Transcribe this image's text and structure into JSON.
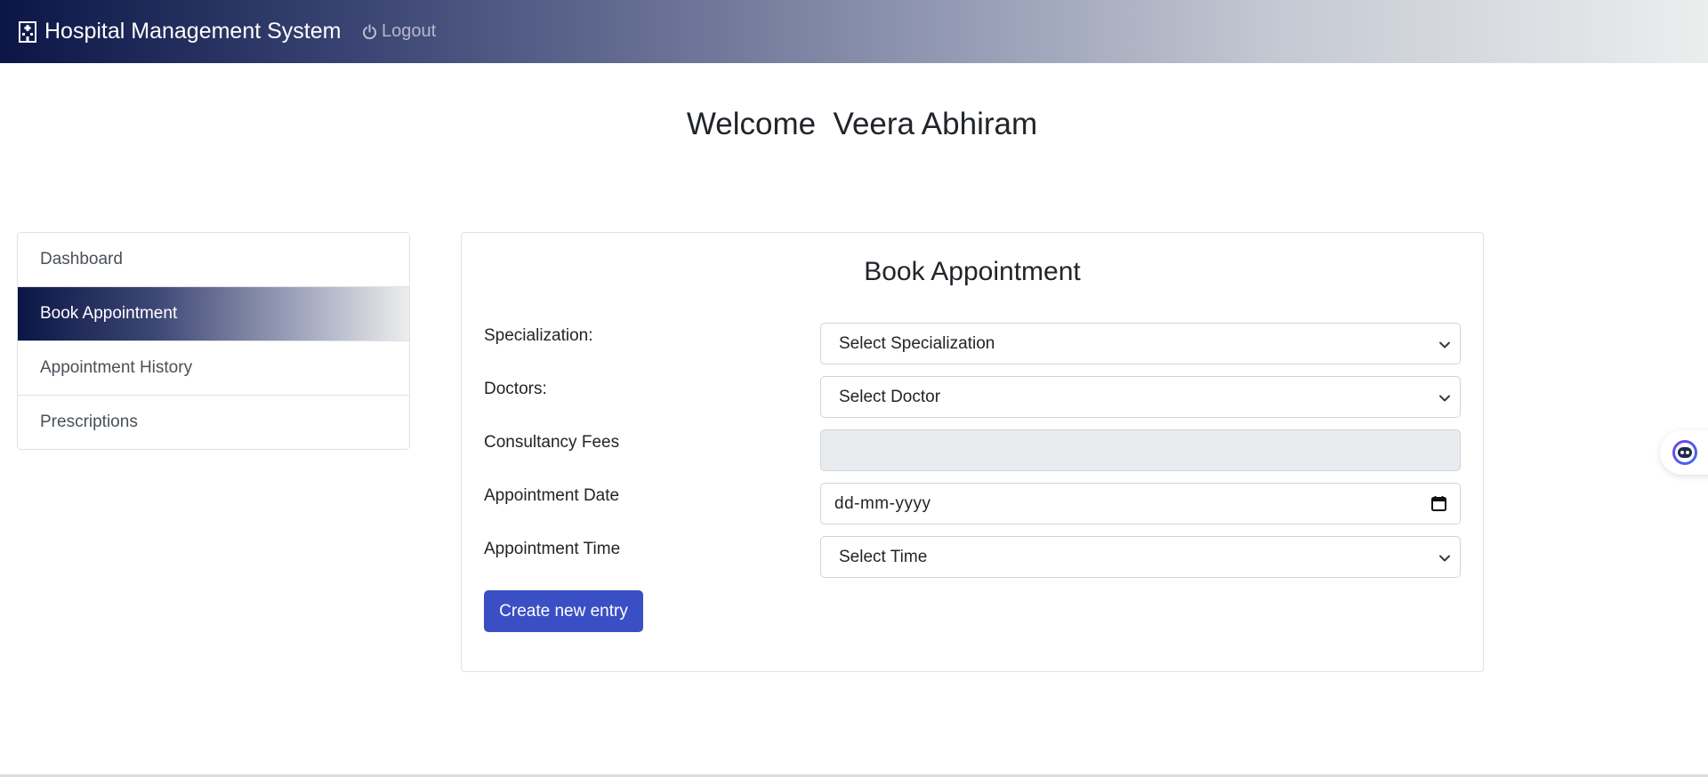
{
  "navbar": {
    "brand": "Hospital Management System",
    "brand_icon": "hospital-icon",
    "logout_label": "Logout",
    "logout_icon": "power-icon"
  },
  "welcome": {
    "text": "Welcome  Veera Abhiram"
  },
  "sidebar": {
    "items": [
      {
        "label": "Dashboard",
        "active": false
      },
      {
        "label": "Book Appointment",
        "active": true
      },
      {
        "label": "Appointment History",
        "active": false
      },
      {
        "label": "Prescriptions",
        "active": false
      }
    ]
  },
  "form": {
    "title": "Book Appointment",
    "specialization": {
      "label": "Specialization:",
      "value": "Select Specialization"
    },
    "doctors": {
      "label": "Doctors:",
      "value": "Select Doctor"
    },
    "fees": {
      "label": "Consultancy Fees",
      "value": ""
    },
    "date": {
      "label": "Appointment Date",
      "placeholder": "dd-mm-yyyy"
    },
    "time": {
      "label": "Appointment Time",
      "value": "Select Time"
    },
    "submit_label": "Create new entry"
  },
  "colors": {
    "navbar_dark": "#0b1646",
    "button_primary": "#3b4fc4",
    "readonly_bg": "#e9ecef"
  }
}
